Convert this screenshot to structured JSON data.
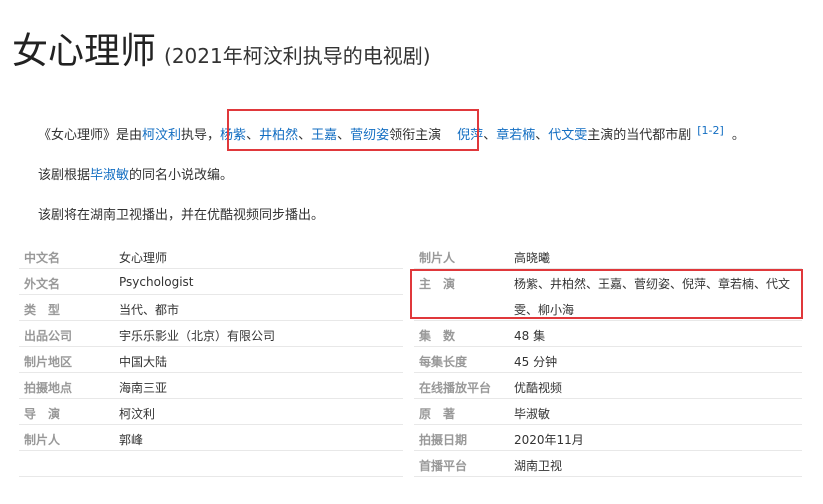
{
  "title": {
    "main": "女心理师",
    "sub": "(2021年柯汶利执导的电视剧)"
  },
  "summary": {
    "p1": {
      "prefix": "《女心理师》是由",
      "director_link": "柯汶利",
      "mid1": "执导，",
      "lead_links": [
        "杨紫",
        "井柏然",
        "王嘉",
        "菅纫姿"
      ],
      "lead_sep": "、",
      "lead_suffix": "领衔主演",
      "co_links": [
        "倪萍",
        "章若楠",
        "代文雯"
      ],
      "co_suffix": "主演的当代都市剧",
      "ref": "[1-2]",
      "end": "。"
    },
    "p2": {
      "prefix": "该剧根据",
      "author_link": "毕淑敏",
      "suffix": "的同名小说改编。"
    },
    "p3": "该剧将在湖南卫视播出，并在优酷视频同步播出。"
  },
  "infobox": {
    "left": [
      {
        "key": "中文名",
        "value": "女心理师"
      },
      {
        "key": "外文名",
        "value": "Psychologist"
      },
      {
        "key": "类　型",
        "value": "当代、都市"
      },
      {
        "key": "出品公司",
        "value": "宇乐乐影业（北京）有限公司"
      },
      {
        "key": "制片地区",
        "value": "中国大陆"
      },
      {
        "key": "拍摄地点",
        "value": "海南三亚"
      },
      {
        "key": "导　演",
        "value": "柯汶利"
      },
      {
        "key": "制片人",
        "value": "郭峰"
      }
    ],
    "right": [
      {
        "key": "制片人",
        "value": "高晓曦"
      },
      {
        "key": "主　演",
        "value": "杨紫、井柏然、王嘉、菅纫姿、倪萍、章若楠、代文",
        "value2": "雯、柳小海"
      },
      {
        "key": "集　数",
        "value": "48 集"
      },
      {
        "key": "每集长度",
        "value": "45 分钟"
      },
      {
        "key": "在线播放平台",
        "value": "优酷视频"
      },
      {
        "key": "原　著",
        "value": "毕淑敏"
      },
      {
        "key": "拍摄日期",
        "value": "2020年11月"
      },
      {
        "key": "首播平台",
        "value": "湖南卫视"
      }
    ]
  },
  "colors": {
    "link": "#136ec2",
    "highlight": "#e0383b",
    "label": "#999999"
  }
}
